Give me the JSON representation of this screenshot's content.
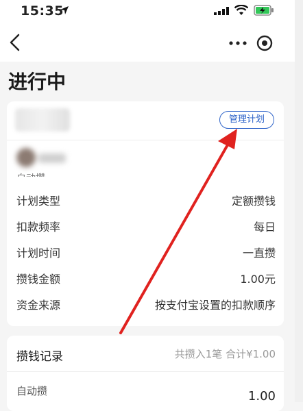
{
  "status": {
    "time": "15:35"
  },
  "page": {
    "title": "进行中"
  },
  "card": {
    "manage_label": "管理计划",
    "subtitle_fragment": "自动攒",
    "rows": [
      {
        "label": "计划类型",
        "value": "定额攒钱"
      },
      {
        "label": "扣款频率",
        "value": "每日"
      },
      {
        "label": "计划时间",
        "value": "一直攒"
      },
      {
        "label": "攒钱金额",
        "value": "1.00元"
      },
      {
        "label": "资金来源",
        "value": "按支付宝设置的扣款顺序"
      }
    ]
  },
  "records": {
    "title": "攒钱记录",
    "summary": "共攒入1笔  合计¥1.00",
    "item_label": "自动攒",
    "item_amount": "1.00"
  },
  "colors": {
    "accent": "#2f64c9",
    "annotation_arrow": "#e0221f",
    "battery": "#33c759"
  },
  "icons": [
    "location-arrow-icon",
    "signal-icon",
    "wifi-icon",
    "battery-charging-icon",
    "back-chevron-icon",
    "more-dots-icon",
    "target-icon"
  ]
}
